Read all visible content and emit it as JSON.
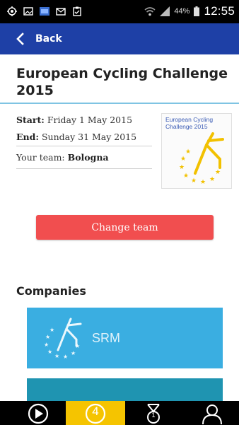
{
  "status_bar": {
    "battery_percent": "44%",
    "time": "12:55",
    "icons": [
      "location-icon",
      "image-icon",
      "gallery-icon",
      "mail-icon",
      "clipboard-icon",
      "wifi-icon",
      "signal-icon",
      "battery-icon"
    ]
  },
  "app_bar": {
    "back_label": "Back",
    "icon": "chevron-left-icon",
    "color": "#1e40a6"
  },
  "challenge": {
    "title": "European Cycling Challenge 2015",
    "start_label": "Start:",
    "start_value": "Friday 1 May 2015",
    "end_label": "End:",
    "end_value": "Sunday 31 May 2015",
    "team_label": "Your team:",
    "team_value": "Bologna",
    "logo_text": "European Cycling Challenge 2015"
  },
  "actions": {
    "change_team_label": "Change team",
    "change_team_color": "#f14e4f"
  },
  "companies": {
    "section_title": "Companies",
    "items": [
      {
        "name": "SRM",
        "color": "#3aaee1"
      },
      {
        "name": "",
        "color": "#1f94b1"
      }
    ]
  },
  "bottom_nav": {
    "items": [
      {
        "icon": "play-icon",
        "active": false
      },
      {
        "icon": "rank-icon",
        "badge": "4",
        "active": true
      },
      {
        "icon": "medal-icon",
        "badge": "1",
        "active": false
      },
      {
        "icon": "profile-icon",
        "active": false
      }
    ],
    "active_color": "#f5c400"
  }
}
